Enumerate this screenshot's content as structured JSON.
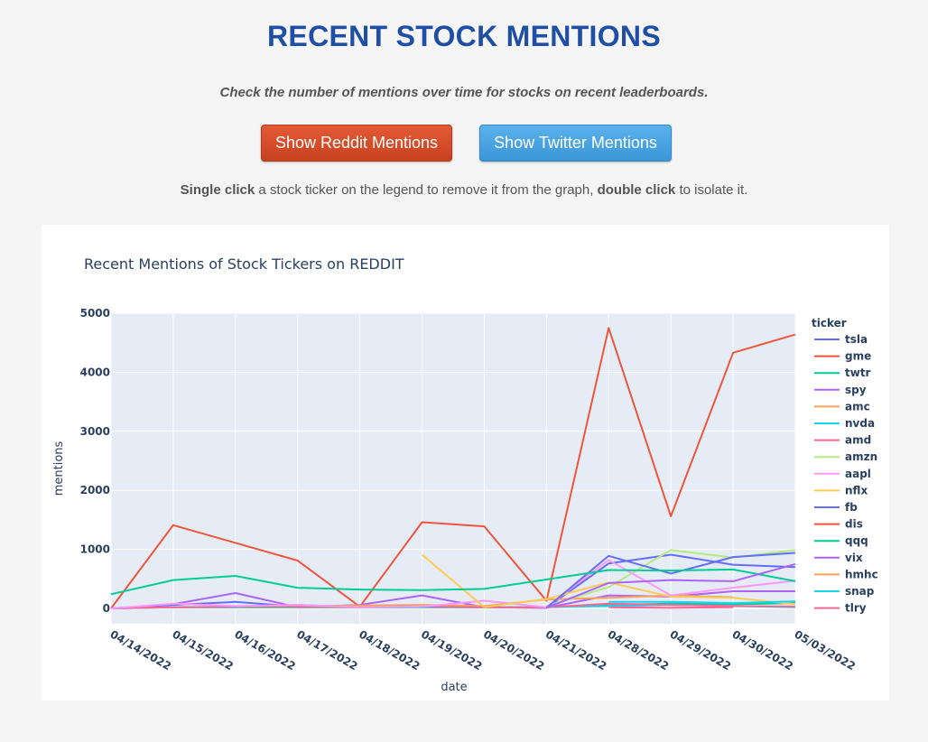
{
  "page": {
    "title": "RECENT STOCK MENTIONS",
    "subtitle": "Check the number of mentions over time for stocks on recent leaderboards.",
    "buttons": {
      "reddit": "Show Reddit Mentions",
      "twitter": "Show Twitter Mentions"
    },
    "instructions": {
      "part1": "Single click",
      "part2": " a stock ticker on the legend to remove it from the graph, ",
      "part3": "double click",
      "part4": " to isolate it."
    }
  },
  "colors": {
    "reddit_button": "#d24a28",
    "twitter_button": "#4aa3e2",
    "title": "#1f4fa5",
    "plot_bg": "#e5ecf6"
  },
  "chart_data": {
    "type": "line",
    "title": "Recent Mentions of Stock Tickers on REDDIT",
    "xlabel": "date",
    "ylabel": "mentions",
    "ylim": [
      -260,
      5000
    ],
    "yticks": [
      0,
      1000,
      2000,
      3000,
      4000,
      5000
    ],
    "x": [
      "04/14/2022",
      "04/15/2022",
      "04/16/2022",
      "04/17/2022",
      "04/18/2022",
      "04/19/2022",
      "04/20/2022",
      "04/21/2022",
      "04/28/2022",
      "04/29/2022",
      "04/30/2022",
      "05/03/2022"
    ],
    "legend_title": "ticker",
    "legend_position": "right",
    "grid": true,
    "series": [
      {
        "name": "tsla",
        "color": "#636efa",
        "values": [
          0,
          60,
          110,
          30,
          20,
          30,
          20,
          10,
          760,
          910,
          740,
          700
        ]
      },
      {
        "name": "gme",
        "color": "#ef553b",
        "values": [
          0,
          1410,
          1110,
          810,
          30,
          1460,
          1390,
          130,
          4750,
          1560,
          4330,
          4640
        ]
      },
      {
        "name": "twtr",
        "color": "#00cc96",
        "values": [
          0,
          20,
          20,
          20,
          20,
          20,
          20,
          20,
          60,
          80,
          70,
          90
        ]
      },
      {
        "name": "spy",
        "color": "#ab63fa",
        "values": [
          0,
          70,
          260,
          20,
          60,
          220,
          20,
          10,
          220,
          200,
          290,
          290
        ]
      },
      {
        "name": "amc",
        "color": "#ffa15a",
        "values": [
          null,
          20,
          30,
          40,
          50,
          60,
          40,
          150,
          180,
          220,
          190,
          null
        ]
      },
      {
        "name": "nvda",
        "color": "#19d3f3",
        "values": [
          0,
          20,
          20,
          60,
          20,
          20,
          20,
          20,
          40,
          60,
          40,
          20
        ]
      },
      {
        "name": "amd",
        "color": "#ff6692",
        "values": [
          0,
          20,
          30,
          30,
          20,
          30,
          20,
          20,
          80,
          60,
          40,
          30
        ]
      },
      {
        "name": "amzn",
        "color": "#b6e880",
        "values": [
          null,
          null,
          null,
          null,
          null,
          null,
          null,
          40,
          360,
          990,
          860,
          990
        ]
      },
      {
        "name": "aapl",
        "color": "#ff97ff",
        "values": [
          0,
          80,
          40,
          60,
          20,
          30,
          130,
          20,
          820,
          220,
          350,
          470
        ]
      },
      {
        "name": "nflx",
        "color": "#fecb52",
        "values": [
          null,
          240,
          null,
          null,
          null,
          910,
          20,
          160,
          440,
          200,
          180,
          70
        ]
      },
      {
        "name": "fb",
        "color": "#636efa",
        "values": [
          null,
          null,
          null,
          null,
          null,
          null,
          null,
          10,
          890,
          590,
          870,
          940
        ]
      },
      {
        "name": "dis",
        "color": "#ef553b",
        "values": [
          null,
          null,
          null,
          null,
          null,
          null,
          null,
          null,
          null,
          null,
          null,
          50
        ]
      },
      {
        "name": "qqq",
        "color": "#00cc96",
        "values": [
          240,
          480,
          550,
          350,
          320,
          310,
          330,
          490,
          650,
          640,
          660,
          460
        ]
      },
      {
        "name": "vix",
        "color": "#ab63fa",
        "values": [
          null,
          null,
          null,
          null,
          null,
          null,
          null,
          10,
          430,
          480,
          460,
          750
        ]
      },
      {
        "name": "hmhc",
        "color": "#ffa15a",
        "values": [
          null,
          null,
          null,
          null,
          null,
          null,
          null,
          null,
          null,
          null,
          null,
          40
        ]
      },
      {
        "name": "snap",
        "color": "#19d3f3",
        "values": [
          null,
          null,
          null,
          null,
          null,
          null,
          null,
          null,
          110,
          110,
          90,
          120
        ]
      },
      {
        "name": "tlry",
        "color": "#ff6692",
        "values": [
          null,
          null,
          null,
          null,
          null,
          null,
          null,
          null,
          20,
          10,
          20,
          null
        ]
      }
    ]
  }
}
